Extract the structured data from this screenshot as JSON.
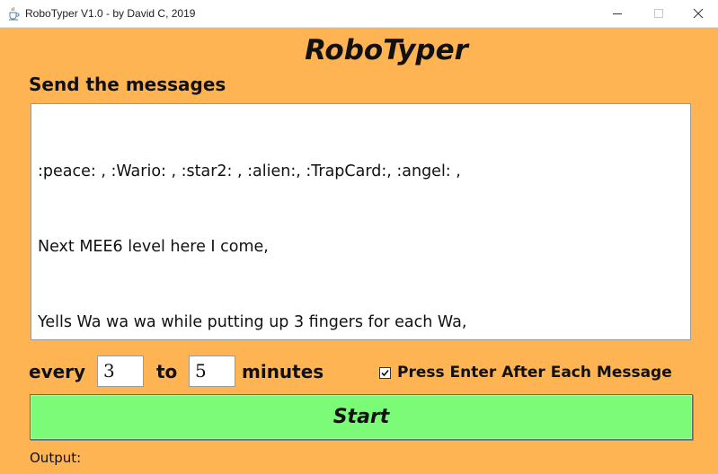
{
  "window": {
    "title": "RoboTyper V1.0 - by David C, 2019",
    "app_icon": "java-cup-icon",
    "controls": [
      "minimize-icon",
      "maximize-icon",
      "close-icon"
    ]
  },
  "app_title": "RoboTyper",
  "messages_section": {
    "label": "Send the messages",
    "lines": [
      ":peace: , :Wario: , :star2: , :alien:, :TrapCard:, :angel: ,",
      "Next MEE6 level here I come,",
      "Yells Wa wa wa while putting up 3 fingers for each Wa,"
    ]
  },
  "interval": {
    "every_label": "every",
    "min_value": "3",
    "to_label": "to",
    "max_value": "5",
    "unit_label": "minutes"
  },
  "enter_option": {
    "label": "Press Enter After Each Message",
    "checked": true
  },
  "start_button": {
    "label": "Start",
    "color": "#7bfb78"
  },
  "output": {
    "label": "Output:"
  },
  "colors": {
    "background": "#ffb454",
    "start_button": "#7bfb78"
  }
}
